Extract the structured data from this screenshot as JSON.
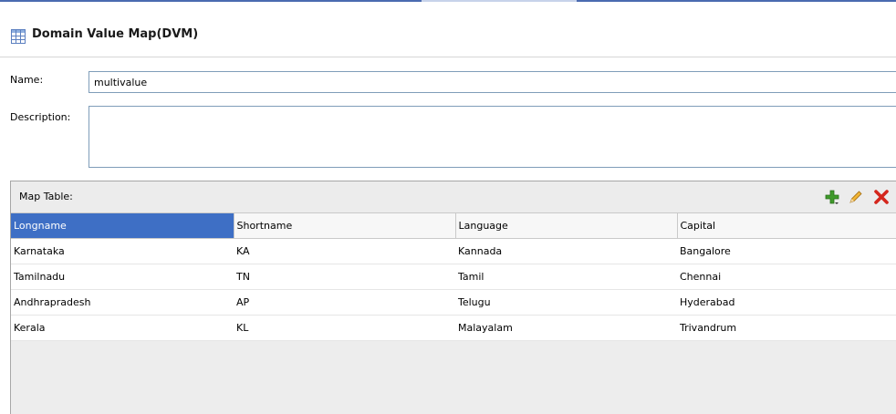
{
  "window": {
    "title": "Domain Value Map(DVM)",
    "icon": "table-grid-icon",
    "accent_color": "#4a6bb0"
  },
  "form": {
    "name_label": "Name:",
    "name_value": "multivalue",
    "description_label": "Description:",
    "description_value": ""
  },
  "map_table": {
    "label": "Map Table:",
    "toolbar": {
      "add_icon": "add-plus-icon",
      "edit_icon": "edit-pencil-icon",
      "delete_icon": "delete-x-icon"
    },
    "selected_header_color": "#3e6fc5",
    "columns": [
      "Longname",
      "Shortname",
      "Language",
      "Capital"
    ],
    "rows": [
      [
        "Karnataka",
        "KA",
        "Kannada",
        "Bangalore"
      ],
      [
        "Tamilnadu",
        "TN",
        "Tamil",
        "Chennai"
      ],
      [
        "Andhrapradesh",
        "AP",
        "Telugu",
        "Hyderabad"
      ],
      [
        "Kerala",
        "KL",
        "Malayalam",
        "Trivandrum"
      ]
    ]
  }
}
